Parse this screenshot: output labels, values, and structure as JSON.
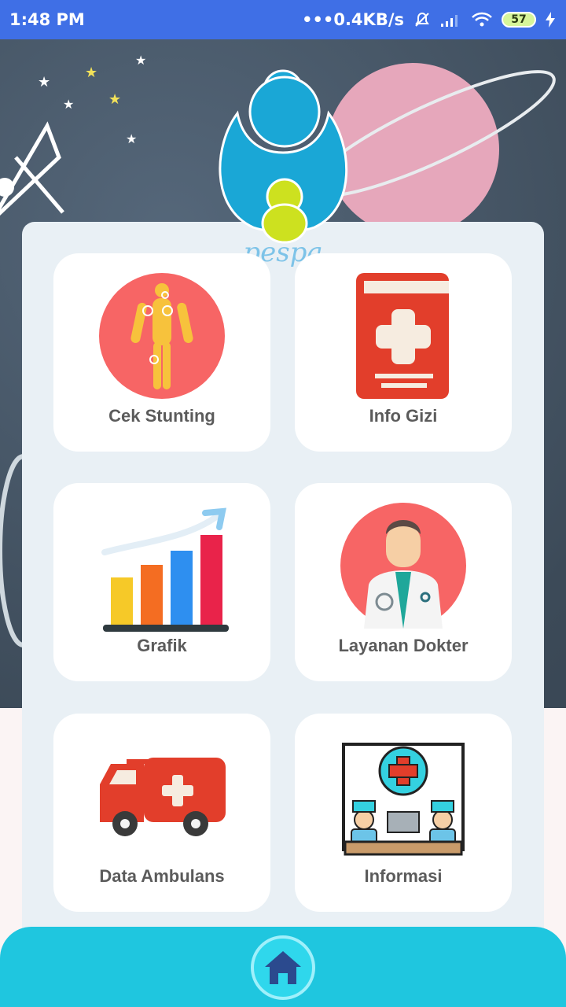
{
  "status_bar": {
    "time": "1:48 PM",
    "network_speed": "•••0.4KB/s",
    "battery_level": "57"
  },
  "app": {
    "logo_text": "pespa"
  },
  "menu": {
    "items": [
      {
        "label": "Cek Stunting",
        "icon": "body-scan-icon"
      },
      {
        "label": "Info Gizi",
        "icon": "medical-book-icon"
      },
      {
        "label": "Grafik",
        "icon": "bar-chart-icon"
      },
      {
        "label": "Layanan Dokter",
        "icon": "doctor-icon"
      },
      {
        "label": "Data Ambulans",
        "icon": "ambulance-icon"
      },
      {
        "label": "Informasi",
        "icon": "hospital-info-icon"
      }
    ]
  },
  "bottom_nav": {
    "home_icon": "home-icon"
  },
  "colors": {
    "status_bar": "#3f6fe6",
    "bottom_nav": "#1fc6df",
    "label": "#5b5b5b"
  }
}
